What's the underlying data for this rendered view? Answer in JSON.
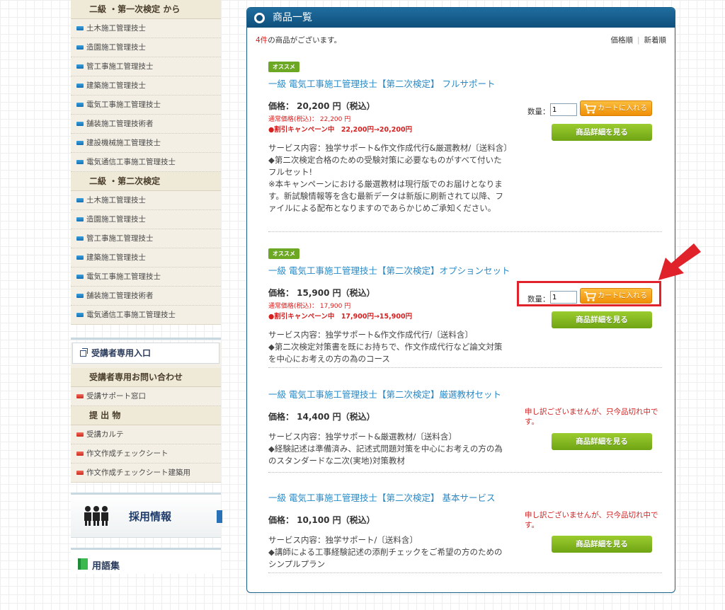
{
  "sidebar": {
    "section1_title": "二級 ・第一次検定 から",
    "section1_items": [
      "土木施工管理技士",
      "造園施工管理技士",
      "管工事施工管理技士",
      "建築施工管理技士",
      "電気工事施工管理技士",
      "舗装施工管理技術者",
      "建設機械施工管理技士",
      "電気通信工事施工管理技士"
    ],
    "section2_title": "二級 ・第二次検定",
    "section2_items": [
      "土木施工管理技士",
      "造園施工管理技士",
      "管工事施工管理技士",
      "建築施工管理技士",
      "電気工事施工管理技士",
      "舗装施工管理技術者",
      "電気通信工事施工管理技士"
    ],
    "entry_label": "受講者専用入口",
    "inquiry_title": "受講者専用お問い合わせ",
    "support_item": "受講サポート窓口",
    "submission_title": "提 出 物",
    "submission_items": [
      "受講カルテ",
      "作文作成チェックシート",
      "作文作成チェックシート建築用"
    ],
    "recruit_label": "採用情報",
    "glossary_label": "用語集"
  },
  "panel": {
    "title": "商品一覧",
    "count_number": "4件",
    "count_text": "の商品がございます。",
    "sort_price": "価格順",
    "sort_new": "新着順"
  },
  "common": {
    "qty_label": "数量：",
    "qty_value": "1",
    "cart_label": "カートに入れる",
    "detail_label": "商品詳細を見る",
    "soldout": "申し訳ございませんが、只今品切れ中です。",
    "badge": "オススメ"
  },
  "products": [
    {
      "title": "一級 電気工事施工管理技士【第二次検定】 フルサポート",
      "price": "価格： 20,200 円（税込）",
      "regular": "通常価格(税込)： 22,200 円",
      "campaign": "●割引キャンペーン中　22,200円→20,200円",
      "desc1": "サービス内容：独学サポート&作文作成代行&厳選教材/〔送料含〕",
      "desc2": "◆第二次検定合格のための受験対策に必要なものがすべて付いたフルセット!",
      "desc3": "※本キャンペーンにおける厳選教材は現行版でのお届けとなります。新試験情報等を含む最新データは新版に刷新されて以降、ファイルによる配布となりますのであらかじめご承知ください。"
    },
    {
      "title": "一級 電気工事施工管理技士【第二次検定】オプションセット",
      "price": "価格： 15,900 円（税込）",
      "regular": "通常価格(税込)： 17,900 円",
      "campaign": "●割引キャンペーン中　17,900円→15,900円",
      "desc1": "サービス内容：独学サポート&作文作成代行/〔送料含〕",
      "desc2": "◆第二次検定対策書を既にお持ちで、作文作成代行など論文対策を中心にお考えの方の為のコース"
    },
    {
      "title": "一級 電気工事施工管理技士【第二次検定】厳選教材セット",
      "price": "価格： 14,400 円（税込）",
      "desc1": "サービス内容：独学サポート&厳選教材/〔送料含〕",
      "desc2": "◆経験記述は準備済み、記述式問題対策を中心にお考えの方の為のスタンダードな二次(実地)対策教材"
    },
    {
      "title": "一級 電気工事施工管理技士【第二次検定】 基本サービス",
      "price": "価格： 10,100 円（税込）",
      "desc1": "サービス内容：独学サポート/〔送料含〕",
      "desc2": "◆講師による工事経験記述の添削チェックをご希望の方のためのシンプルプラン"
    }
  ],
  "colors": {
    "header_blue": "#0f4f7c",
    "link_blue": "#2a8ac6",
    "campaign_red": "#d62020",
    "cart_orange": "#ef8f06",
    "detail_green": "#6fa414",
    "badge_green": "#6ca824",
    "annotation_red": "#e0232a"
  }
}
